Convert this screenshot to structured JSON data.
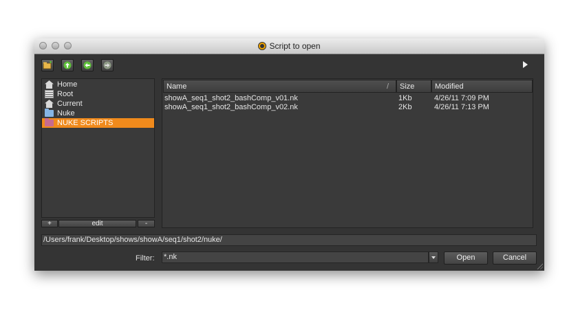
{
  "window": {
    "title": "Script to open"
  },
  "toolbar": {
    "buttons": [
      "new-folder",
      "up",
      "back",
      "forward"
    ]
  },
  "sidebar": {
    "items": [
      {
        "label": "Home",
        "icon": "home-icon"
      },
      {
        "label": "Root",
        "icon": "server-icon"
      },
      {
        "label": "Current",
        "icon": "home-icon"
      },
      {
        "label": "Nuke",
        "icon": "folder-icon"
      },
      {
        "label": "NUKE SCRIPTS",
        "icon": "folder-icon",
        "selected": true
      }
    ],
    "add_label": "+",
    "edit_label": "edit",
    "remove_label": "-"
  },
  "files": {
    "columns": [
      "Name",
      "Size",
      "Modified"
    ],
    "name_sort_glyph": "/",
    "rows": [
      {
        "name": "showA_seq1_shot2_bashComp_v01.nk",
        "size": "1Kb",
        "modified": "4/26/11 7:09 PM"
      },
      {
        "name": "showA_seq1_shot2_bashComp_v02.nk",
        "size": "2Kb",
        "modified": "4/26/11 7:13 PM"
      }
    ]
  },
  "path": {
    "value": "/Users/frank/Desktop/shows/showA/seq1/shot2/nuke/"
  },
  "filter": {
    "label": "Filter:",
    "value": "*.nk"
  },
  "actions": {
    "open_label": "Open",
    "cancel_label": "Cancel"
  },
  "colors": {
    "selection": "#f08a1c",
    "background": "#343434",
    "toolbar_button_green": "#5fc13a"
  }
}
